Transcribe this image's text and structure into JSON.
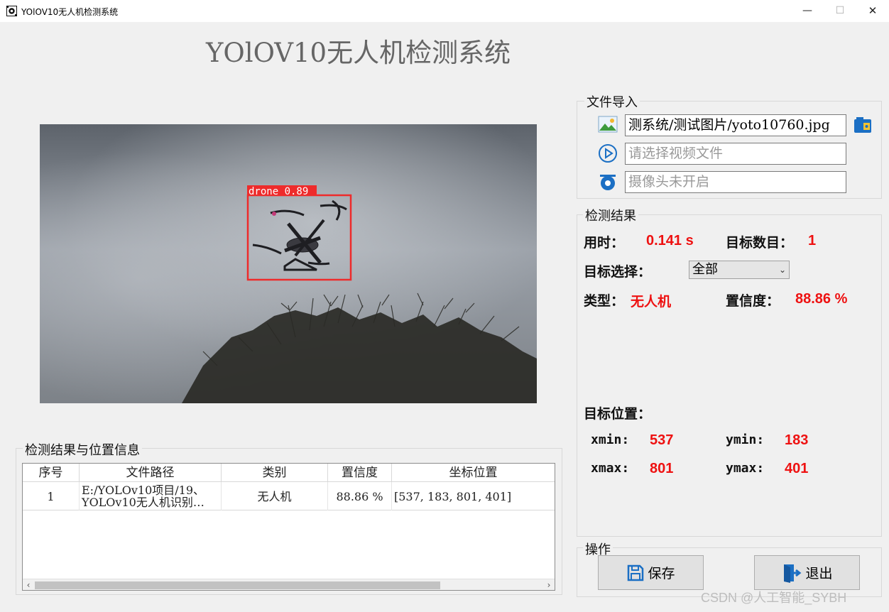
{
  "window": {
    "title": "YOlOV10无人机检测系统",
    "minimize": "—",
    "maximize": "☐",
    "close": "✕"
  },
  "main_title": "YOlOV10无人机检测系统",
  "image": {
    "detection_label": "drone 0.89",
    "box_color": "#ee2b2b"
  },
  "file_import": {
    "legend": "文件导入",
    "image_path": "测系统/测试图片/yoto10760.jpg",
    "video_placeholder": "请选择视频文件",
    "camera_placeholder": "摄像头未开启"
  },
  "result": {
    "legend": "检测结果",
    "time_label": "用时：",
    "time_value": "0.141 s",
    "count_label": "目标数目：",
    "count_value": "1",
    "select_label": "目标选择：",
    "select_value": "全部",
    "type_label": "类型：",
    "type_value": "无人机",
    "conf_label": "置信度：",
    "conf_value": "88.86 %",
    "pos_label": "目标位置：",
    "xmin_label": "xmin:",
    "xmin_value": "537",
    "ymin_label": "ymin:",
    "ymin_value": "183",
    "xmax_label": "xmax:",
    "xmax_value": "801",
    "ymax_label": "ymax:",
    "ymax_value": "401"
  },
  "ops": {
    "legend": "操作",
    "save_label": "保存",
    "exit_label": "退出"
  },
  "table": {
    "legend": "检测结果与位置信息",
    "headers": [
      "序号",
      "文件路径",
      "类别",
      "置信度",
      "坐标位置"
    ],
    "rows": [
      {
        "index": "1",
        "path_line1": "E:/YOLOv10项目/19、",
        "path_line2": "YOLOv10无人机识别…",
        "class": "无人机",
        "confidence": "88.86 %",
        "coords": "[537, 183, 801, 401]"
      }
    ]
  },
  "watermark": "CSDN @人工智能_SYBH",
  "colors": {
    "accent_red": "#ee1111",
    "icon_blue": "#1b6fc4"
  }
}
